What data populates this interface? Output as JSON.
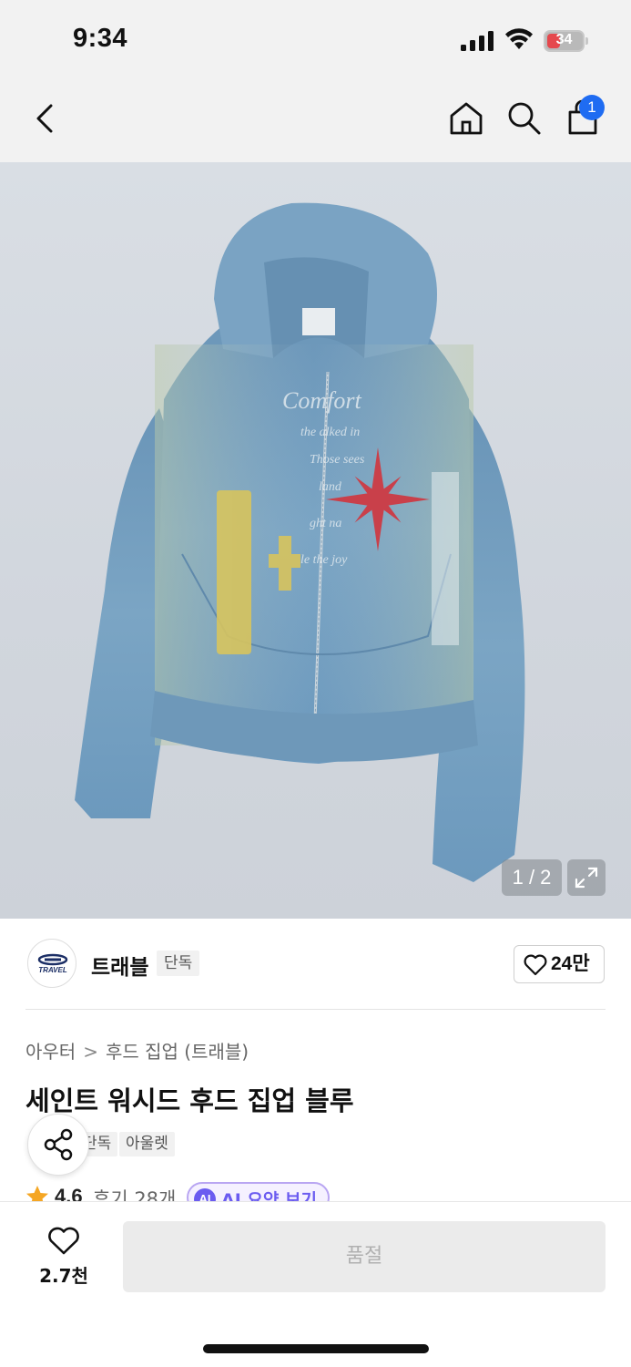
{
  "status_bar": {
    "time": "9:34",
    "battery": "34",
    "icons": [
      "signal-icon",
      "wifi-icon",
      "battery-icon"
    ]
  },
  "nav": {
    "icons": [
      "back-arrow-icon",
      "home-icon",
      "search-icon",
      "shopping-bag-icon"
    ],
    "cart_badge": "1"
  },
  "gallery": {
    "counter": "1 / 2",
    "expand_icon": "expand-icon"
  },
  "brand": {
    "logo_text": "TRAVEL",
    "name": "트래블",
    "badge": "단독",
    "like_count": "24만"
  },
  "breadcrumb": {
    "items": [
      "아우터",
      "후드 집업 (트래블)"
    ],
    "separator": ">"
  },
  "product": {
    "title": "세인트 워시드 후드 집업 블루",
    "tags": [
      "단독",
      "아울렛"
    ],
    "rating": "4.6",
    "review_count": "후기 28개",
    "ai_badge": "AI",
    "ai_summary": "AI 요약 보기"
  },
  "colors": {
    "accent": "#1f6cf2",
    "ai_purple": "#6b5cf0",
    "star": "#f5a623"
  },
  "bottom": {
    "wish_count": "2.7천",
    "soldout_label": "품절"
  }
}
